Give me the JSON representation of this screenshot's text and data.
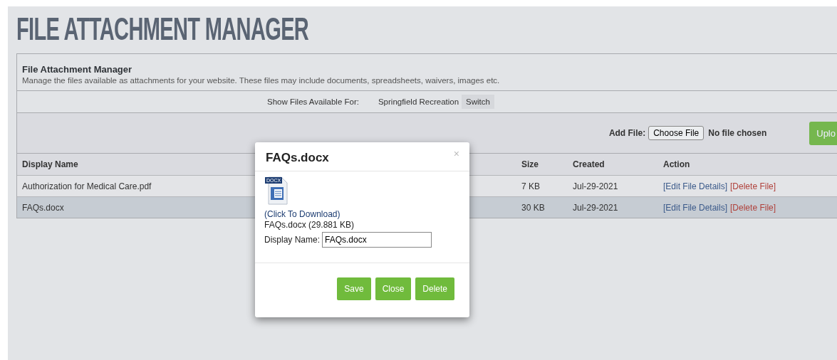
{
  "page_title": "FILE ATTACHMENT MANAGER",
  "panel": {
    "title": "File Attachment Manager",
    "description": "Manage the files available as attachments for your website. These files may include documents, spreadsheets, waivers, images etc."
  },
  "filter": {
    "label": "Show Files Available For:",
    "value": "Springfield Recreation",
    "button": "Switch"
  },
  "upload": {
    "label": "Add File:",
    "choose_button": "Choose File",
    "status": "No file chosen",
    "button": "Uplo"
  },
  "table": {
    "columns": [
      "Display Name",
      "Size",
      "Created",
      "Action"
    ],
    "rows": [
      {
        "name": "Authorization for Medical Care.pdf",
        "size": "7 KB",
        "created": "Jul-29-2021",
        "edit": "[Edit File Details]",
        "delete": "[Delete File]",
        "selected": false
      },
      {
        "name": "FAQs.docx",
        "size": "30 KB",
        "created": "Jul-29-2021",
        "edit": "[Edit File Details]",
        "delete": "[Delete File]",
        "selected": true
      }
    ]
  },
  "dialog": {
    "title": "FAQs.docx",
    "close": "×",
    "icon_label": "DOCX",
    "download_link": "(Click To Download)",
    "file_info": "FAQs.docx (29.881 KB)",
    "field_label": "Display Name:",
    "field_value": "FAQs.docx",
    "buttons": [
      "Save",
      "Close",
      "Delete"
    ]
  }
}
